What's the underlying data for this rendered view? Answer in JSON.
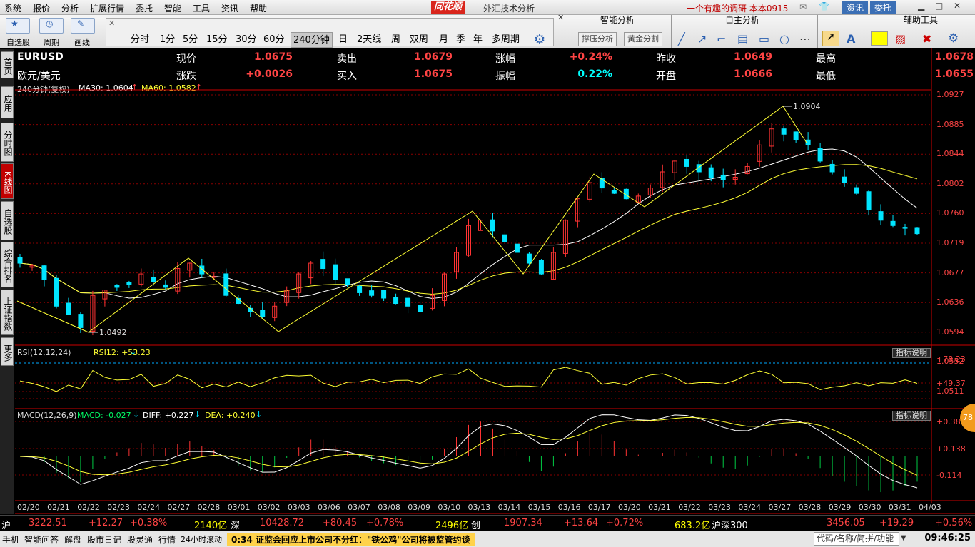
{
  "menu": {
    "items": [
      "系统",
      "报价",
      "分析",
      "扩展行情",
      "委托",
      "智能",
      "工具",
      "资讯",
      "帮助"
    ],
    "brand": "同花顺",
    "title": "- 外汇技术分析",
    "user": "一个有趣的调研   本本0915",
    "zixun": "资讯",
    "weituo": "委托"
  },
  "toolbar": {
    "labels": [
      "自选股",
      "周期",
      "画线"
    ],
    "periods": [
      "分时",
      "1分",
      "5分",
      "15分",
      "30分",
      "60分",
      "240分钟",
      "日",
      "2天线",
      "周",
      "双周",
      "月",
      "季",
      "年",
      "多周期"
    ],
    "selected_period": "240分钟",
    "panel_smart": "智能分析",
    "panel_self": "自主分析",
    "panel_aux": "辅助工具",
    "btn_support": "撑压分析",
    "btn_golden": "黄金分割"
  },
  "colors": {
    "up": "#ff3333",
    "down": "#00e5ff",
    "ma30": "#ffffff",
    "ma60": "#ffff33",
    "diff": "#ffffff",
    "dea": "#ffff33"
  },
  "left_tabs": [
    "首页",
    "应用",
    "分时图",
    "K线图",
    "自选股",
    "综合排名",
    "上证指数",
    "更多"
  ],
  "quote": {
    "symbol": "EURUSD",
    "name": "欧元/美元",
    "rows": [
      [
        {
          "k": "现价",
          "v": "1.0675"
        },
        {
          "k": "卖出",
          "v": "1.0679"
        },
        {
          "k": "涨幅",
          "v": "+0.24%"
        },
        {
          "k": "昨收",
          "v": "1.0649"
        },
        {
          "k": "最高",
          "v": "1.0678"
        }
      ],
      [
        {
          "k": "涨跌",
          "v": "+0.0026"
        },
        {
          "k": "买入",
          "v": "1.0675"
        },
        {
          "k": "振幅",
          "v": "0.22%"
        },
        {
          "k": "开盘",
          "v": "1.0666"
        },
        {
          "k": "最低",
          "v": "1.0655"
        }
      ]
    ]
  },
  "ma_line": {
    "period": "240分钟(复权)",
    "ma30": "MA30: 1.0604",
    "ma60": "MA60: 1.0582"
  },
  "price_axis": [
    "1.0927",
    "1.0885",
    "1.0844",
    "1.0802",
    "1.0760",
    "1.0719",
    "1.0677",
    "1.0636",
    "1.0594",
    "1.0552",
    "1.0511"
  ],
  "annotations": {
    "high": "1.0904",
    "low": "1.0492"
  },
  "rsi": {
    "label": "RSI(12,12,24)",
    "value": "RSI12: +53.23",
    "axis": [
      "+78.23",
      "+49.37"
    ],
    "btn": "指标说明"
  },
  "macd": {
    "label": "MACD(12,26,9)",
    "macd": "MACD: -0.027",
    "diff": "DIFF: +0.227",
    "dea": "DEA: +0.240",
    "axis": [
      "+0.383",
      "+0.138",
      "-0.114"
    ],
    "btn": "指标说明"
  },
  "dates": [
    "02/20",
    "02/21",
    "02/22",
    "02/23",
    "02/24",
    "02/27",
    "02/28",
    "03/01",
    "03/02",
    "03/03",
    "03/06",
    "03/07",
    "03/08",
    "03/09",
    "03/10",
    "03/13",
    "03/14",
    "03/15",
    "03/16",
    "03/17",
    "03/20",
    "03/21",
    "03/22",
    "03/23",
    "03/24",
    "03/27",
    "03/28",
    "03/29",
    "03/30",
    "03/31",
    "04/03"
  ],
  "status": {
    "sh": "沪",
    "sh_val": "3222.51",
    "sh_chg": "+12.27",
    "sh_pct": "+0.38%",
    "sh_amt": "2140亿",
    "sz": "深",
    "sz_val": "10428.72",
    "sz_chg": "+80.45",
    "sz_pct": "+0.78%",
    "sz_amt": "2496亿",
    "cy": "创",
    "cy_val": "1907.34",
    "cy_chg": "+13.64",
    "cy_pct": "+0.72%",
    "hs_amt": "683.2亿",
    "hs": "沪深300",
    "hs_val": "3456.05",
    "hs_chg": "+19.29",
    "hs_pct": "+0.56%"
  },
  "bottom": {
    "items": [
      "手机",
      "智能问答",
      "解盘",
      "股市日记",
      "股灵通",
      "行情",
      "24小时滚动"
    ],
    "ticker": "0:34 证监会回应上市公司不分红：\"铁公鸡\"公司将被监管约谈",
    "search": "代码/名称/简拼/功能",
    "time": "09:46:25",
    "badge": "78"
  },
  "chart_data": {
    "type": "candlestick",
    "instrument": "EURUSD",
    "period": "240分钟",
    "ylim": [
      1.047,
      1.094
    ],
    "series_close": [
      1.062,
      1.0615,
      1.059,
      1.054,
      1.0525,
      1.05,
      1.056,
      1.057,
      1.0575,
      1.058,
      1.06,
      1.0585,
      1.0575,
      1.061,
      1.062,
      1.06,
      1.0595,
      1.056,
      1.0545,
      1.053,
      1.052,
      1.054,
      1.057,
      1.06,
      1.062,
      1.061,
      1.059,
      1.058,
      1.0565,
      1.056,
      1.0555,
      1.0545,
      1.054,
      1.053,
      1.056,
      1.06,
      1.064,
      1.069,
      1.07,
      1.068,
      1.066,
      1.064,
      1.062,
      1.06,
      1.064,
      1.07,
      1.074,
      1.077,
      1.076,
      1.075,
      1.074,
      1.0745,
      1.076,
      1.079,
      1.081,
      1.08,
      1.079,
      1.078,
      1.0775,
      1.078,
      1.08,
      1.084,
      1.087,
      1.086,
      1.085,
      1.084,
      1.081,
      1.079,
      1.077,
      1.075,
      1.072,
      1.07,
      1.069,
      1.0685,
      1.0675
    ]
  }
}
